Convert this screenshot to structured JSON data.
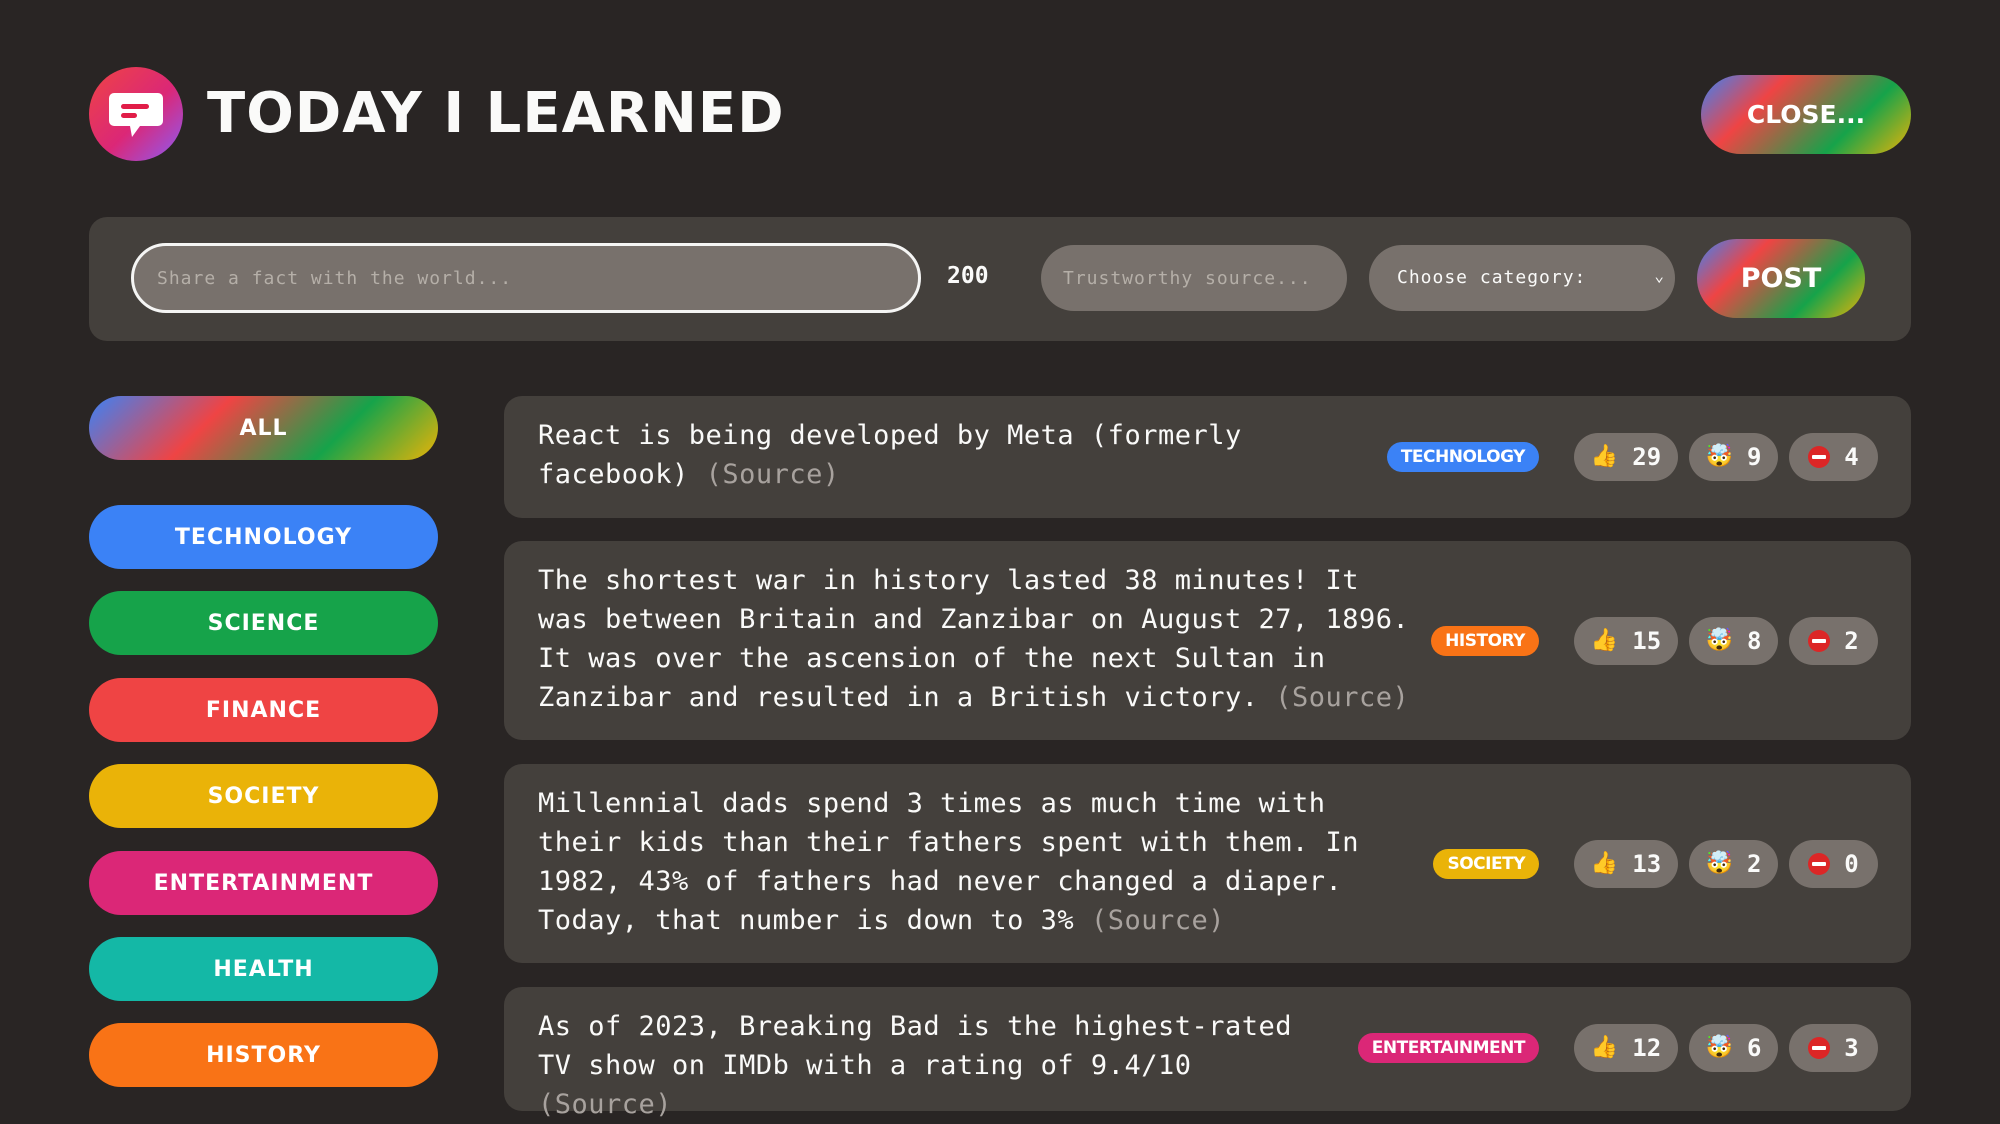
{
  "app": {
    "title": "Today I Learned",
    "close_label": "Close..."
  },
  "form": {
    "fact_placeholder": "Share a fact with the world...",
    "char_count": "200",
    "source_placeholder": "Trustworthy source...",
    "category_label": "Choose category:",
    "post_label": "Post"
  },
  "categories": [
    {
      "label": "All",
      "color": "gradient"
    },
    {
      "label": "Technology",
      "color": "#3b82f6"
    },
    {
      "label": "Science",
      "color": "#16a34a"
    },
    {
      "label": "Finance",
      "color": "#ef4444"
    },
    {
      "label": "Society",
      "color": "#eab308"
    },
    {
      "label": "Entertainment",
      "color": "#db2777"
    },
    {
      "label": "Health",
      "color": "#14b8a6"
    },
    {
      "label": "History",
      "color": "#f97316"
    }
  ],
  "facts": [
    {
      "text": "React is being developed by Meta (formerly facebook)",
      "source": "(Source)",
      "category": "Technology",
      "color": "#3b82f6",
      "votes": {
        "interesting": "29",
        "mindblowing": "9",
        "false": "4"
      }
    },
    {
      "text": "The shortest war in history lasted 38 minutes! It was between Britain and Zanzibar on August 27, 1896. It was over the ascension of the next Sultan in Zanzibar and resulted in a British victory.",
      "source": "(Source)",
      "category": "History",
      "color": "#f97316",
      "votes": {
        "interesting": "15",
        "mindblowing": "8",
        "false": "2"
      }
    },
    {
      "text": "Millennial dads spend 3 times as much time with their kids than their fathers spent with them. In 1982, 43% of fathers had never changed a diaper. Today, that number is down to 3%",
      "source": "(Source)",
      "category": "Society",
      "color": "#eab308",
      "votes": {
        "interesting": "13",
        "mindblowing": "2",
        "false": "0"
      }
    },
    {
      "text": "As of 2023, Breaking Bad is the highest-rated TV show on IMDb with a rating of 9.4/10",
      "source": "(Source)",
      "category": "Entertainment",
      "color": "#db2777",
      "votes": {
        "interesting": "12",
        "mindblowing": "6",
        "false": "3"
      }
    }
  ],
  "icons": {
    "logo": "speech-bubble-icon",
    "interesting": "thumbs-up-icon",
    "mindblowing": "mind-blown-face-icon",
    "false": "no-entry-icon"
  }
}
